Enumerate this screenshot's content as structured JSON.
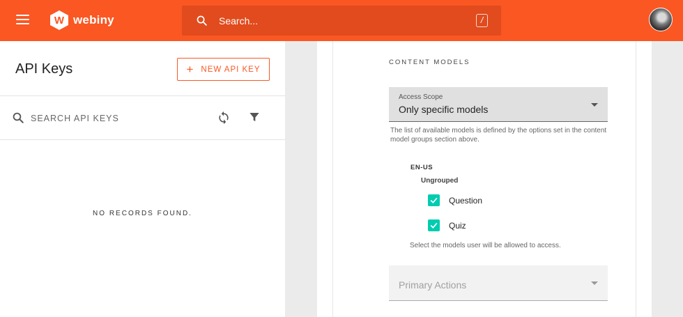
{
  "header": {
    "brand": "webiny",
    "logo_letter": "W",
    "search_placeholder": "Search...",
    "shortcut_key": "/",
    "icons": [
      "menu-icon",
      "search-icon",
      "avatar"
    ],
    "brand_color": "#fa5723"
  },
  "left_panel": {
    "title": "API Keys",
    "new_button_label": "NEW API KEY",
    "search_placeholder": "SEARCH API KEYS",
    "empty_message": "NO RECORDS FOUND.",
    "icons": [
      "search-icon",
      "refresh-icon",
      "filter-icon"
    ]
  },
  "content_models": {
    "section_title": "CONTENT MODELS",
    "access_scope": {
      "label": "Access Scope",
      "value": "Only specific models"
    },
    "scope_helper": "The list of available models is defined by the options set in the content model groups section above.",
    "locale": "EN-US",
    "group_name": "Ungrouped",
    "models": [
      {
        "name": "Question",
        "checked": true
      },
      {
        "name": "Quiz",
        "checked": true
      }
    ],
    "models_helper": "Select the models user will be allowed to access.",
    "primary_actions_placeholder": "Primary Actions",
    "checkbox_color": "#00ccb0"
  }
}
